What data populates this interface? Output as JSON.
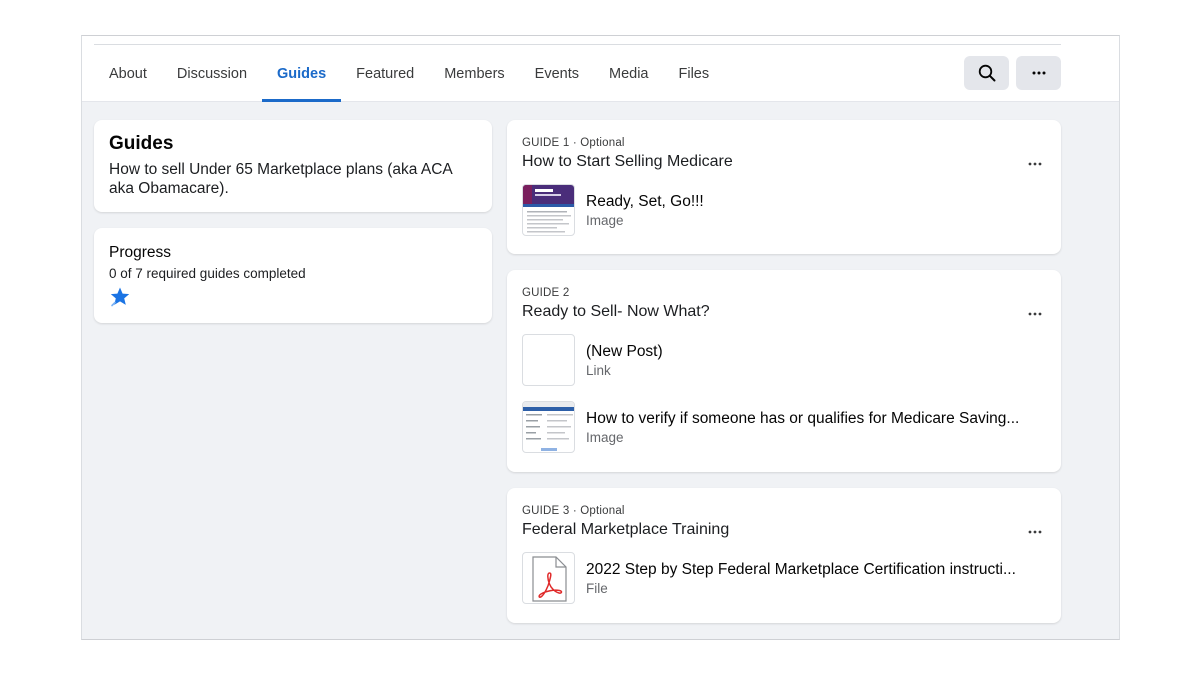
{
  "tabs": [
    {
      "label": "About"
    },
    {
      "label": "Discussion"
    },
    {
      "label": "Guides"
    },
    {
      "label": "Featured"
    },
    {
      "label": "Members"
    },
    {
      "label": "Events"
    },
    {
      "label": "Media"
    },
    {
      "label": "Files"
    }
  ],
  "active_tab": "Guides",
  "accent_color": "#1b6ac9",
  "about": {
    "title": "Guides",
    "description": "How to sell Under 65 Marketplace plans (aka ACA aka Obamacare)."
  },
  "progress": {
    "title": "Progress",
    "status": "0 of 7 required guides completed"
  },
  "guides": [
    {
      "label": "GUIDE 1",
      "tag": " · Optional",
      "title": "How to Start Selling Medicare",
      "items": [
        {
          "title": "Ready, Set, Go!!!",
          "type": "Image",
          "thumb": "document-image-thumbnail"
        }
      ]
    },
    {
      "label": "GUIDE 2",
      "tag": "",
      "title": "Ready to Sell- Now What?",
      "items": [
        {
          "title": "(New Post)",
          "type": "Link",
          "thumb": "blank-thumbnail"
        },
        {
          "title": "How to verify if someone has or qualifies for Medicare Saving...",
          "type": "Image",
          "thumb": "screenshot-thumbnail"
        }
      ]
    },
    {
      "label": "GUIDE 3",
      "tag": " · Optional",
      "title": "Federal Marketplace Training",
      "items": [
        {
          "title": "2022 Step by Step Federal Marketplace Certification instructi...",
          "type": "File",
          "thumb": "pdf-file-icon"
        }
      ]
    }
  ]
}
